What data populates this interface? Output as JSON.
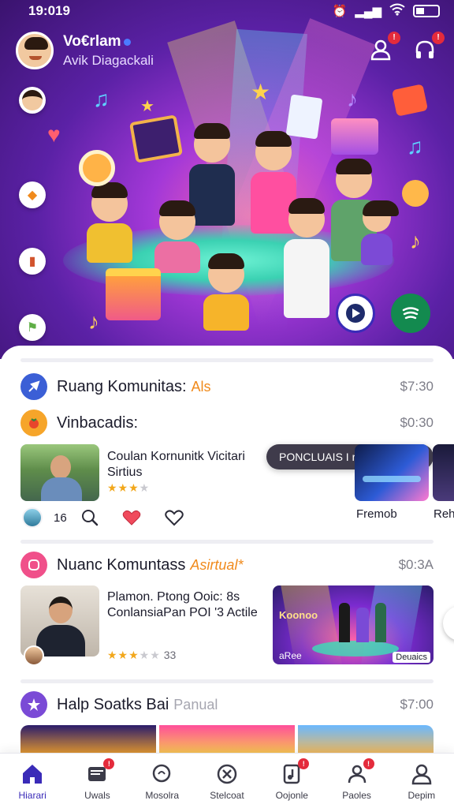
{
  "status_bar": {
    "time": "19:019"
  },
  "profile": {
    "name": "Vo€rlam",
    "subtitle": "Avik Diagackali"
  },
  "top_actions": [
    {
      "icon": "person-icon",
      "badge": "!"
    },
    {
      "icon": "headphones-icon",
      "badge": "!"
    }
  ],
  "side_rail": [
    {
      "icon": "avatar"
    },
    {
      "icon": "tag-icon"
    },
    {
      "icon": "book-icon"
    },
    {
      "icon": "flag-icon"
    }
  ],
  "sections": {
    "s1": {
      "title": "Ruang Komunitas:",
      "tag": "Als",
      "price": "$7:30"
    },
    "s2": {
      "title": "Vinbacadis:",
      "price": "$0:30"
    },
    "s3": {
      "title": "Nuanc Komuntass",
      "tag": "Asirtual*",
      "price": "$0:3A"
    },
    "s4": {
      "title": "Halp Soatks Bai",
      "tag": "Panual",
      "price": "$7:00"
    }
  },
  "cards": {
    "c1": {
      "title": "Coulan Kornunitk Vicitari Sirtius",
      "rating": "★★★",
      "rating_off": "★"
    },
    "c1_actions": {
      "count": "16"
    },
    "c1_right_a": {
      "caption": "Fremob"
    },
    "c1_right_b": {
      "caption": "Reh"
    },
    "tooltip": "PONCLUAIS I rePONG-1HO",
    "c2": {
      "title": "Plamon. Ptong Ooic: 8s ConlansiaPan POI '3 Actile",
      "rating": "★★★",
      "rating_off": "★★",
      "count": "33"
    },
    "c2_thumb": {
      "label_left": "Koonoo",
      "label_bottom": "aRee",
      "label_corner": "Deuaics"
    }
  },
  "bottom_nav": [
    {
      "label": "Hiarari",
      "icon": "home-icon",
      "active": true,
      "badge": ""
    },
    {
      "label": "Uwals",
      "icon": "inbox-icon",
      "active": false,
      "badge": "!"
    },
    {
      "label": "Mosolra",
      "icon": "search-icon",
      "active": false,
      "badge": ""
    },
    {
      "label": "Stelcoat",
      "icon": "cancel-circle-icon",
      "active": false,
      "badge": ""
    },
    {
      "label": "Oojonle",
      "icon": "music-note-icon",
      "active": false,
      "badge": "!"
    },
    {
      "label": "Paoles",
      "icon": "people-icon",
      "active": false,
      "badge": "!"
    },
    {
      "label": "Depim",
      "icon": "profile-icon",
      "active": false,
      "badge": ""
    }
  ],
  "colors": {
    "accent": "#3a2bb8",
    "hero_purple": "#5b21a6",
    "badge_red": "#e42b3c",
    "tag_orange": "#f08a1c"
  }
}
